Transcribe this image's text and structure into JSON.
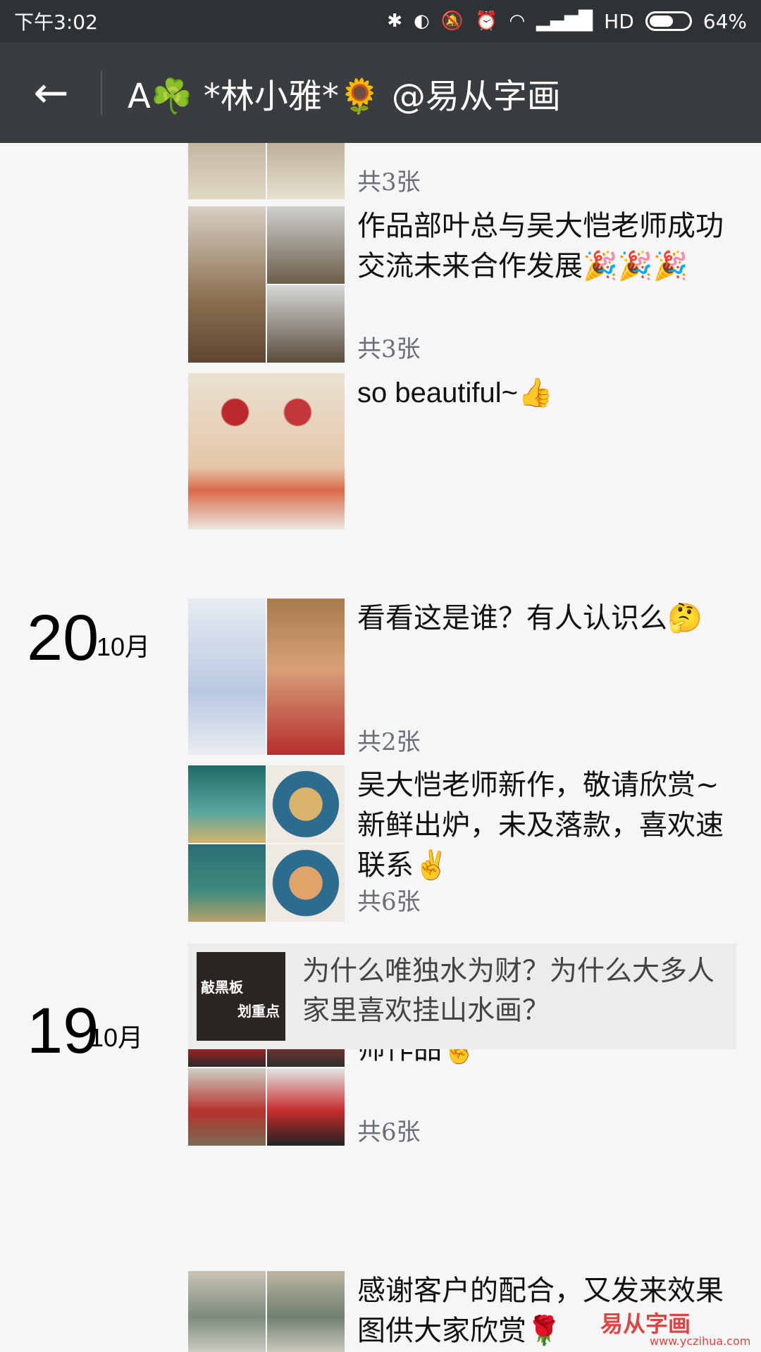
{
  "status_bar": {
    "time": "下午3:02",
    "network": "HD",
    "battery": "64%",
    "battery_level": 0.64
  },
  "title_bar": {
    "title": "A☘️ *林小雅*🌻 @易从字画"
  },
  "posts": [
    {
      "text": "",
      "count": "共3张"
    },
    {
      "text": "作品部叶总与吴大恺老师成功交流未来合作发展🎉🎉🎉",
      "count": "共3张"
    },
    {
      "text": "so beautiful~👍",
      "count": ""
    },
    {
      "text": "看看这是谁？有人认识么🤔",
      "count": "共2张"
    },
    {
      "text": "吴大恺老师新作，敬请欣赏~新鲜出炉，未及落款，喜欢速联系✌️",
      "count": "共6张"
    },
    {
      "text": "拜访吴大恺老师，顺便欣赏老师作品✌️",
      "count": "共6张"
    },
    {
      "text": "感谢客户的配合，又发来效果图供大家欣赏🌹",
      "count": ""
    }
  ],
  "dates": [
    {
      "day": "20",
      "month": "10月"
    },
    {
      "day": "19",
      "month": "10月"
    }
  ],
  "article": {
    "thumb_line1": "敲黑板",
    "thumb_line2": "划重点",
    "title": "为什么唯独水为财？为什么大多人家里喜欢挂山水画？"
  },
  "watermark": {
    "text": "易从字画",
    "url": "www.yczihua.com"
  }
}
